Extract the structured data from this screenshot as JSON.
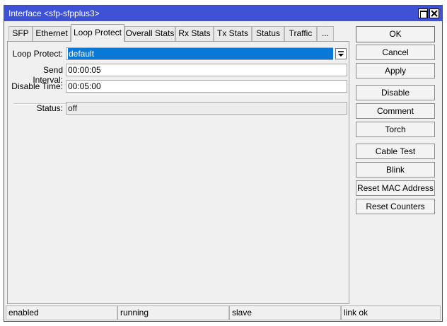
{
  "window": {
    "title": "Interface <sfp-sfpplus3>"
  },
  "tabs": [
    {
      "label": "SFP"
    },
    {
      "label": "Ethernet"
    },
    {
      "label": "Loop Protect"
    },
    {
      "label": "Overall Stats"
    },
    {
      "label": "Rx Stats"
    },
    {
      "label": "Tx Stats"
    },
    {
      "label": "Status"
    },
    {
      "label": "Traffic"
    },
    {
      "label": "..."
    }
  ],
  "active_tab": "Loop Protect",
  "form": {
    "loop_protect": {
      "label": "Loop Protect:",
      "value": "default"
    },
    "send_interval": {
      "label": "Send Interval:",
      "value": "00:00:05"
    },
    "disable_time": {
      "label": "Disable Time:",
      "value": "00:05:00"
    },
    "status": {
      "label": "Status:",
      "value": "off"
    }
  },
  "buttons": {
    "ok": "OK",
    "cancel": "Cancel",
    "apply": "Apply",
    "disable": "Disable",
    "comment": "Comment",
    "torch": "Torch",
    "cable_test": "Cable Test",
    "blink": "Blink",
    "reset_mac": "Reset MAC Address",
    "reset_counters": "Reset Counters"
  },
  "statusbar": [
    "enabled",
    "running",
    "slave",
    "link ok"
  ],
  "colors": {
    "titlebar": "#3d52d6",
    "selection": "#0a78d7"
  }
}
